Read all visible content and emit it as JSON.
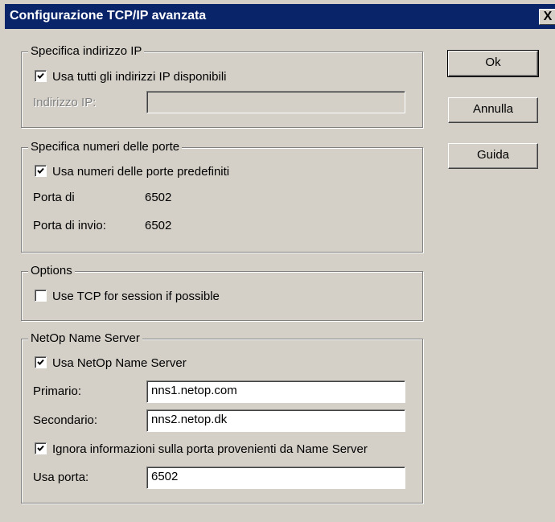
{
  "window": {
    "title": "Configurazione TCP/IP avanzata",
    "close_label": "X"
  },
  "ip_group": {
    "legend": "Specifica indirizzo IP",
    "use_all_label": "Usa tutti gli indirizzi IP disponibili",
    "use_all_checked": true,
    "ip_label": "Indirizzo IP:",
    "ip_value": ""
  },
  "ports_group": {
    "legend": "Specifica numeri delle porte",
    "use_default_label": "Usa numeri delle porte predefiniti",
    "use_default_checked": true,
    "port_label": "Porta di",
    "port_value": "6502",
    "send_port_label": "Porta di invio:",
    "send_port_value": "6502"
  },
  "options_group": {
    "legend": "Options",
    "use_tcp_label": "Use TCP for session if possible",
    "use_tcp_checked": false
  },
  "nameserver_group": {
    "legend": "NetOp Name Server",
    "use_ns_label": "Usa NetOp Name Server",
    "use_ns_checked": true,
    "primary_label": "Primario:",
    "primary_value": "nns1.netop.com",
    "secondary_label": "Secondario:",
    "secondary_value": "nns2.netop.dk",
    "ignore_label": "Ignora informazioni sulla porta provenienti da Name Server",
    "ignore_checked": true,
    "use_port_label": "Usa porta:",
    "use_port_value": "6502"
  },
  "buttons": {
    "ok": "Ok",
    "cancel": "Annulla",
    "help": "Guida"
  }
}
